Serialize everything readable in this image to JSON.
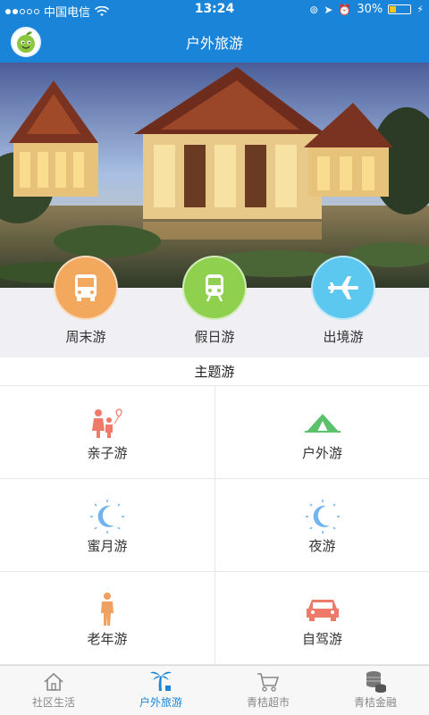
{
  "status_bar": {
    "carrier": "中国电信",
    "time": "13:24",
    "battery": "30%",
    "battery_level": 0.3
  },
  "header": {
    "title": "户外旅游"
  },
  "quick_links": [
    {
      "label": "周末游",
      "icon": "bus-icon",
      "color": "#f2a95e"
    },
    {
      "label": "假日游",
      "icon": "train-icon",
      "color": "#8fd14f"
    },
    {
      "label": "出境游",
      "icon": "airplane-icon",
      "color": "#5cc8ef"
    }
  ],
  "section": {
    "title": "主题游"
  },
  "themes": [
    {
      "label": "亲子游",
      "icon": "family-icon",
      "color": "#f07a6a"
    },
    {
      "label": "户外游",
      "icon": "tent-icon",
      "color": "#5bc16b"
    },
    {
      "label": "蜜月游",
      "icon": "moon-icon",
      "color": "#6fb3f0"
    },
    {
      "label": "夜游",
      "icon": "moon-icon",
      "color": "#6fb3f0"
    },
    {
      "label": "老年游",
      "icon": "elder-icon",
      "color": "#f0a060"
    },
    {
      "label": "自驾游",
      "icon": "car-icon",
      "color": "#f07a6a"
    }
  ],
  "tabs": [
    {
      "label": "社区生活",
      "icon": "home-icon",
      "active": false
    },
    {
      "label": "户外旅游",
      "icon": "palm-tree-icon",
      "active": true
    },
    {
      "label": "青桔超市",
      "icon": "cart-icon",
      "active": false
    },
    {
      "label": "青桔金融",
      "icon": "coins-icon",
      "active": false
    }
  ]
}
